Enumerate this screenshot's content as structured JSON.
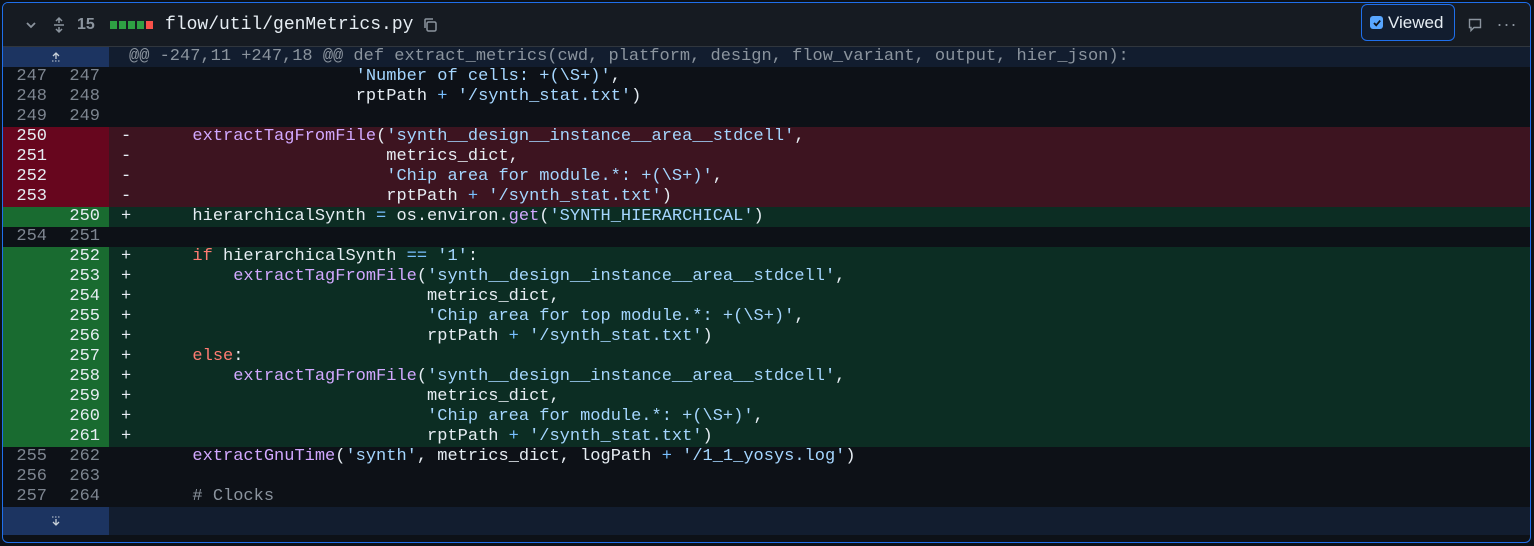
{
  "header": {
    "changes_count": "15",
    "diffstat": [
      "#2ea043",
      "#2ea043",
      "#2ea043",
      "#2ea043",
      "#f85149"
    ],
    "filename": "flow/util/genMetrics.py",
    "viewed_label": "Viewed",
    "viewed_checked": true,
    "icons": [
      "chevron-down-icon",
      "expand-all-icon",
      "copy-icon",
      "comment-icon",
      "kebab-icon"
    ]
  },
  "hunk_header": "@@ -247,11 +247,18 @@ def extract_metrics(cwd, platform, design, flow_variant, output, hier_json):",
  "lines": [
    {
      "type": "norm",
      "old": "247",
      "new": "247",
      "sign": " ",
      "tokens": [
        {
          "t": "                    "
        },
        {
          "t": "'Number of cells: +(\\S+)'",
          "c": "str"
        },
        {
          "t": ","
        }
      ]
    },
    {
      "type": "norm",
      "old": "248",
      "new": "248",
      "sign": " ",
      "tokens": [
        {
          "t": "                    rptPath "
        },
        {
          "t": "+",
          "c": "op"
        },
        {
          "t": " "
        },
        {
          "t": "'/synth_stat.txt'",
          "c": "str"
        },
        {
          "t": ")"
        }
      ]
    },
    {
      "type": "norm",
      "old": "249",
      "new": "249",
      "sign": " ",
      "tokens": [
        {
          "t": ""
        }
      ]
    },
    {
      "type": "del",
      "old": "250",
      "new": "",
      "sign": "-",
      "tokens": [
        {
          "t": "    "
        },
        {
          "t": "extractTagFromFile",
          "c": "fnc"
        },
        {
          "t": "("
        },
        {
          "t": "'synth__design__instance__area__stdcell'",
          "c": "str"
        },
        {
          "t": ","
        }
      ]
    },
    {
      "type": "del",
      "old": "251",
      "new": "",
      "sign": "-",
      "tokens": [
        {
          "t": "                       metrics_dict,"
        }
      ]
    },
    {
      "type": "del",
      "old": "252",
      "new": "",
      "sign": "-",
      "tokens": [
        {
          "t": "                       "
        },
        {
          "t": "'Chip area for module.*: +(\\S+)'",
          "c": "str"
        },
        {
          "t": ","
        }
      ]
    },
    {
      "type": "del",
      "old": "253",
      "new": "",
      "sign": "-",
      "tokens": [
        {
          "t": "                       rptPath "
        },
        {
          "t": "+",
          "c": "op"
        },
        {
          "t": " "
        },
        {
          "t": "'/synth_stat.txt'",
          "c": "str"
        },
        {
          "t": ")"
        }
      ]
    },
    {
      "type": "add",
      "old": "",
      "new": "250",
      "sign": "+",
      "tokens": [
        {
          "t": "    hierarchicalSynth "
        },
        {
          "t": "=",
          "c": "op"
        },
        {
          "t": " os.environ."
        },
        {
          "t": "get",
          "c": "fnc"
        },
        {
          "t": "("
        },
        {
          "t": "'SYNTH_HIERARCHICAL'",
          "c": "str"
        },
        {
          "t": ")"
        }
      ]
    },
    {
      "type": "norm",
      "old": "254",
      "new": "251",
      "sign": " ",
      "tokens": [
        {
          "t": ""
        }
      ]
    },
    {
      "type": "add",
      "old": "",
      "new": "252",
      "sign": "+",
      "tokens": [
        {
          "t": "    "
        },
        {
          "t": "if",
          "c": "kw"
        },
        {
          "t": " hierarchicalSynth "
        },
        {
          "t": "==",
          "c": "op"
        },
        {
          "t": " "
        },
        {
          "t": "'1'",
          "c": "str"
        },
        {
          "t": ":"
        }
      ]
    },
    {
      "type": "add",
      "old": "",
      "new": "253",
      "sign": "+",
      "tokens": [
        {
          "t": "        "
        },
        {
          "t": "extractTagFromFile",
          "c": "fnc"
        },
        {
          "t": "("
        },
        {
          "t": "'synth__design__instance__area__stdcell'",
          "c": "str"
        },
        {
          "t": ","
        }
      ]
    },
    {
      "type": "add",
      "old": "",
      "new": "254",
      "sign": "+",
      "tokens": [
        {
          "t": "                           metrics_dict,"
        }
      ]
    },
    {
      "type": "add",
      "old": "",
      "new": "255",
      "sign": "+",
      "tokens": [
        {
          "t": "                           "
        },
        {
          "t": "'Chip area for top module.*: +(\\S+)'",
          "c": "str"
        },
        {
          "t": ","
        }
      ]
    },
    {
      "type": "add",
      "old": "",
      "new": "256",
      "sign": "+",
      "tokens": [
        {
          "t": "                           rptPath "
        },
        {
          "t": "+",
          "c": "op"
        },
        {
          "t": " "
        },
        {
          "t": "'/synth_stat.txt'",
          "c": "str"
        },
        {
          "t": ")"
        }
      ]
    },
    {
      "type": "add",
      "old": "",
      "new": "257",
      "sign": "+",
      "tokens": [
        {
          "t": "    "
        },
        {
          "t": "else",
          "c": "kw"
        },
        {
          "t": ":"
        }
      ]
    },
    {
      "type": "add",
      "old": "",
      "new": "258",
      "sign": "+",
      "tokens": [
        {
          "t": "        "
        },
        {
          "t": "extractTagFromFile",
          "c": "fnc"
        },
        {
          "t": "("
        },
        {
          "t": "'synth__design__instance__area__stdcell'",
          "c": "str"
        },
        {
          "t": ","
        }
      ]
    },
    {
      "type": "add",
      "old": "",
      "new": "259",
      "sign": "+",
      "tokens": [
        {
          "t": "                           metrics_dict,"
        }
      ]
    },
    {
      "type": "add",
      "old": "",
      "new": "260",
      "sign": "+",
      "tokens": [
        {
          "t": "                           "
        },
        {
          "t": "'Chip area for module.*: +(\\S+)'",
          "c": "str"
        },
        {
          "t": ","
        }
      ]
    },
    {
      "type": "add",
      "old": "",
      "new": "261",
      "sign": "+",
      "tokens": [
        {
          "t": "                           rptPath "
        },
        {
          "t": "+",
          "c": "op"
        },
        {
          "t": " "
        },
        {
          "t": "'/synth_stat.txt'",
          "c": "str"
        },
        {
          "t": ")"
        }
      ]
    },
    {
      "type": "norm",
      "old": "255",
      "new": "262",
      "sign": " ",
      "tokens": [
        {
          "t": "    "
        },
        {
          "t": "extractGnuTime",
          "c": "fnc"
        },
        {
          "t": "("
        },
        {
          "t": "'synth'",
          "c": "str"
        },
        {
          "t": ", metrics_dict, logPath "
        },
        {
          "t": "+",
          "c": "op"
        },
        {
          "t": " "
        },
        {
          "t": "'/1_1_yosys.log'",
          "c": "str"
        },
        {
          "t": ")"
        }
      ]
    },
    {
      "type": "norm",
      "old": "256",
      "new": "263",
      "sign": " ",
      "tokens": [
        {
          "t": ""
        }
      ]
    },
    {
      "type": "norm",
      "old": "257",
      "new": "264",
      "sign": " ",
      "tokens": [
        {
          "t": "    "
        },
        {
          "t": "# Clocks",
          "c": "cm"
        }
      ]
    }
  ]
}
